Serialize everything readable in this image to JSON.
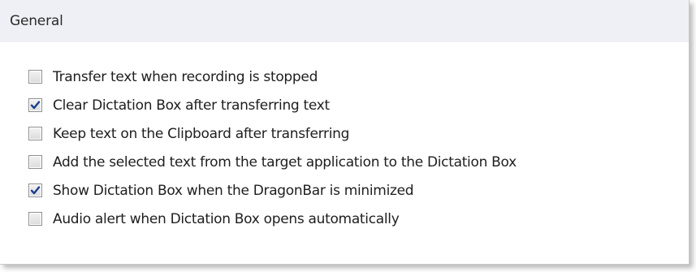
{
  "section": {
    "title": "General"
  },
  "options": [
    {
      "label": "Transfer text when recording is stopped",
      "checked": false
    },
    {
      "label": "Clear Dictation Box after transferring text",
      "checked": true
    },
    {
      "label": "Keep text on the Clipboard after transferring",
      "checked": false
    },
    {
      "label": "Add the selected text from the target application to the Dictation Box",
      "checked": false
    },
    {
      "label": "Show Dictation Box when the DragonBar is minimized",
      "checked": true
    },
    {
      "label": "Audio alert when Dictation Box opens automatically",
      "checked": false
    }
  ],
  "colors": {
    "header_bg": "#eef0f5",
    "checkmark": "#1a3f8c",
    "checkbox_border": "#8e8f8f"
  }
}
